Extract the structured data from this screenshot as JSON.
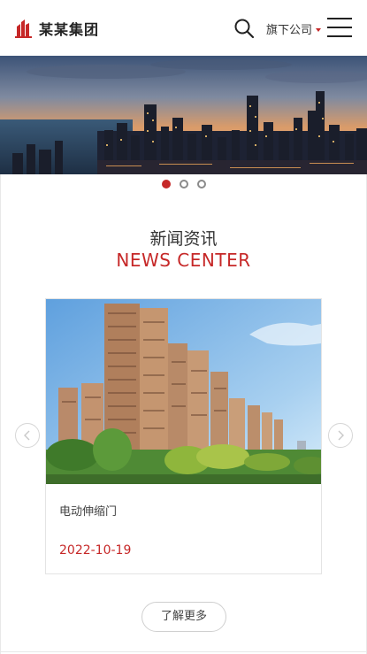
{
  "header": {
    "brand_name": "某某集团",
    "company_menu_label": "旗下公司",
    "accent_color": "#c62828"
  },
  "banner": {
    "slide_count": 3,
    "active_slide": 1
  },
  "news_section": {
    "title_cn": "新闻资讯",
    "title_en": "NEWS CENTER",
    "items": [
      {
        "title": "电动伸缩门",
        "date": "2022-10-19"
      }
    ],
    "more_label": "了解更多"
  },
  "icons": {
    "logo": "building-logo-icon",
    "search": "search-icon",
    "menu": "hamburger-menu-icon",
    "prev": "chevron-left-icon",
    "next": "chevron-right-icon"
  }
}
